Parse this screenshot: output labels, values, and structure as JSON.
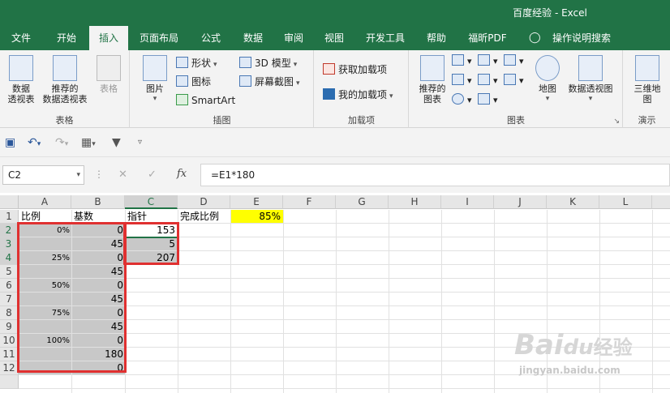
{
  "title": "百度经验  -  Excel",
  "tabs": [
    "文件",
    "开始",
    "插入",
    "页面布局",
    "公式",
    "数据",
    "审阅",
    "视图",
    "开发工具",
    "帮助",
    "福昕PDF",
    "操作说明搜索"
  ],
  "ribbon": {
    "tables": {
      "pivot": "数据\n透视表",
      "recommended_pivot": "推荐的\n数据透视表",
      "table": "表格",
      "group": "表格"
    },
    "illustrations": {
      "picture": "图片",
      "shapes": "形状",
      "icons": "图标",
      "smartart": "SmartArt",
      "model3d": "3D 模型",
      "screenshot": "屏幕截图",
      "group": "插图"
    },
    "addins": {
      "get": "获取加载项",
      "mine": "我的加载项",
      "group": "加载项"
    },
    "charts": {
      "recommended": "推荐的\n图表",
      "map": "地图",
      "pivotchart": "数据透视图",
      "group": "图表"
    },
    "tours": {
      "map3d": "三维地\n图",
      "group": "演示"
    }
  },
  "formula_bar": {
    "name_box": "C2",
    "formula": "=E1*180",
    "fx": "fx"
  },
  "columns": [
    "A",
    "B",
    "C",
    "D",
    "E",
    "F",
    "G",
    "H",
    "I",
    "J",
    "K",
    "L"
  ],
  "rows": [
    "1",
    "2",
    "3",
    "4",
    "5",
    "6",
    "7",
    "8",
    "9",
    "10",
    "11",
    "12"
  ],
  "cells": {
    "A1": "比例",
    "B1": "基数",
    "C1": "指针",
    "D1": "完成比例",
    "E1": "85%",
    "A2": "0%",
    "B2": "0",
    "C2": "153",
    "B3": "45",
    "C3": "5",
    "A4": "25%",
    "B4": "0",
    "C4": "207",
    "B5": "45",
    "A6": "50%",
    "B6": "0",
    "B7": "45",
    "A8": "75%",
    "B8": "0",
    "B9": "45",
    "A10": "100%",
    "B10": "0",
    "B11": "180",
    "B12": "0"
  },
  "watermark": {
    "main": "Bai",
    "du": "du",
    "jingyan": "经验",
    "url": "jingyan.baidu.com"
  },
  "colors": {
    "excel_green": "#217346",
    "highlight_gray": "#c8c8c8",
    "highlight_yellow": "#ffff00",
    "annotation_red": "#e03030"
  }
}
